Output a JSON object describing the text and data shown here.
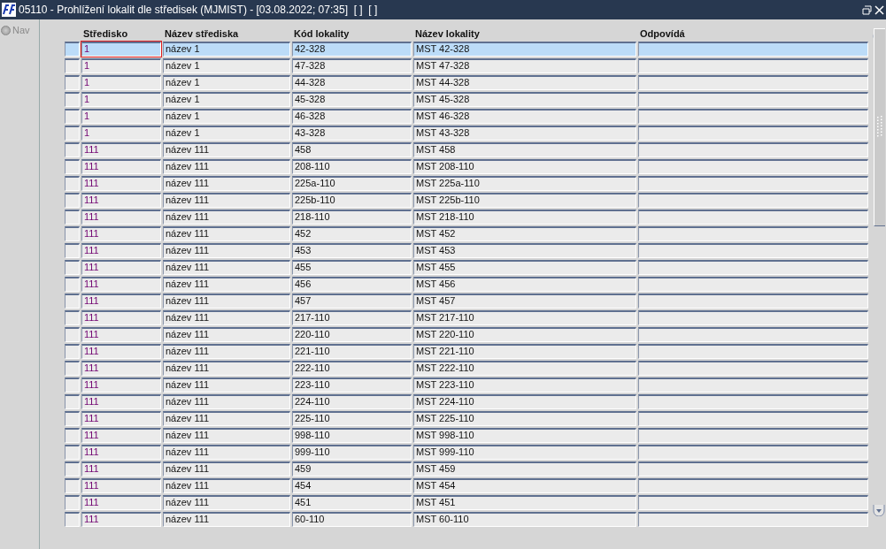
{
  "window": {
    "title": "05110 - Prohlížení lokalit dle středisek (MJMIST) - [03.08.2022; 07:35]  [ ]  [ ]"
  },
  "nav": {
    "label": "Nav",
    "selected": false
  },
  "table": {
    "columns": [
      "Středisko",
      "Název střediska",
      "Kód lokality",
      "Název lokality",
      "Odpovídá"
    ],
    "rows": [
      {
        "selected": true,
        "cells": [
          "1",
          "název 1",
          "42-328",
          "MST 42-328",
          ""
        ]
      },
      {
        "selected": false,
        "cells": [
          "1",
          "název 1",
          "47-328",
          "MST 47-328",
          ""
        ]
      },
      {
        "selected": false,
        "cells": [
          "1",
          "název 1",
          "44-328",
          "MST 44-328",
          ""
        ]
      },
      {
        "selected": false,
        "cells": [
          "1",
          "název 1",
          "45-328",
          "MST 45-328",
          ""
        ]
      },
      {
        "selected": false,
        "cells": [
          "1",
          "název 1",
          "46-328",
          "MST 46-328",
          ""
        ]
      },
      {
        "selected": false,
        "cells": [
          "1",
          "název 1",
          "43-328",
          "MST 43-328",
          ""
        ]
      },
      {
        "selected": false,
        "cells": [
          "111",
          "název 111",
          "458",
          "MST 458",
          ""
        ]
      },
      {
        "selected": false,
        "cells": [
          "111",
          "název 111",
          "208-110",
          "MST 208-110",
          ""
        ]
      },
      {
        "selected": false,
        "cells": [
          "111",
          "název 111",
          "225a-110",
          "MST 225a-110",
          ""
        ]
      },
      {
        "selected": false,
        "cells": [
          "111",
          "název 111",
          "225b-110",
          "MST 225b-110",
          ""
        ]
      },
      {
        "selected": false,
        "cells": [
          "111",
          "název 111",
          "218-110",
          "MST 218-110",
          ""
        ]
      },
      {
        "selected": false,
        "cells": [
          "111",
          "název 111",
          "452",
          "MST 452",
          ""
        ]
      },
      {
        "selected": false,
        "cells": [
          "111",
          "název 111",
          "453",
          "MST 453",
          ""
        ]
      },
      {
        "selected": false,
        "cells": [
          "111",
          "název 111",
          "455",
          "MST 455",
          ""
        ]
      },
      {
        "selected": false,
        "cells": [
          "111",
          "název 111",
          "456",
          "MST 456",
          ""
        ]
      },
      {
        "selected": false,
        "cells": [
          "111",
          "název 111",
          "457",
          "MST 457",
          ""
        ]
      },
      {
        "selected": false,
        "cells": [
          "111",
          "název 111",
          "217-110",
          "MST 217-110",
          ""
        ]
      },
      {
        "selected": false,
        "cells": [
          "111",
          "název 111",
          "220-110",
          "MST 220-110",
          ""
        ]
      },
      {
        "selected": false,
        "cells": [
          "111",
          "název 111",
          "221-110",
          "MST 221-110",
          ""
        ]
      },
      {
        "selected": false,
        "cells": [
          "111",
          "název 111",
          "222-110",
          "MST 222-110",
          ""
        ]
      },
      {
        "selected": false,
        "cells": [
          "111",
          "název 111",
          "223-110",
          "MST 223-110",
          ""
        ]
      },
      {
        "selected": false,
        "cells": [
          "111",
          "název 111",
          "224-110",
          "MST 224-110",
          ""
        ]
      },
      {
        "selected": false,
        "cells": [
          "111",
          "název 111",
          "225-110",
          "MST 225-110",
          ""
        ]
      },
      {
        "selected": false,
        "cells": [
          "111",
          "název 111",
          "998-110",
          "MST 998-110",
          ""
        ]
      },
      {
        "selected": false,
        "cells": [
          "111",
          "název 111",
          "999-110",
          "MST 999-110",
          ""
        ]
      },
      {
        "selected": false,
        "cells": [
          "111",
          "název 111",
          "459",
          "MST 459",
          ""
        ]
      },
      {
        "selected": false,
        "cells": [
          "111",
          "název 111",
          "454",
          "MST 454",
          ""
        ]
      },
      {
        "selected": false,
        "cells": [
          "111",
          "název 111",
          "451",
          "MST 451",
          ""
        ]
      },
      {
        "selected": false,
        "cells": [
          "111",
          "název 111",
          "60-110",
          "MST 60-110",
          ""
        ]
      }
    ]
  }
}
